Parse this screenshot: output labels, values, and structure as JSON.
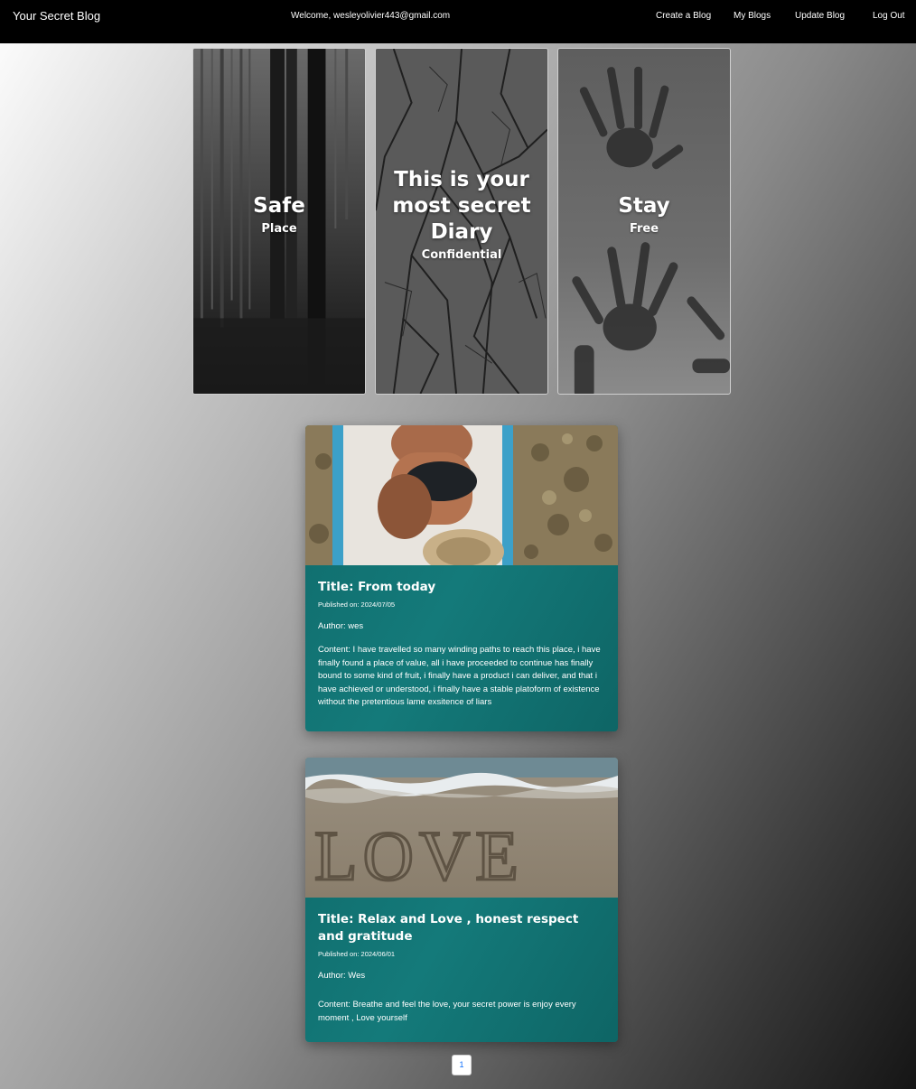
{
  "navbar": {
    "brand": "Your Secret Blog",
    "welcome": "Welcome, wesleyolivier443@gmail.com",
    "links": [
      "Create a Blog",
      "My Blogs",
      "Update Blog",
      "Log Out"
    ]
  },
  "hero": [
    {
      "title": "Safe",
      "subtitle": "Place"
    },
    {
      "title": "This is your most secret Diary",
      "subtitle": "Confidential"
    },
    {
      "title": "Stay",
      "subtitle": "Free"
    }
  ],
  "posts": [
    {
      "title": "Title: From today",
      "published": "Published on: 2024/07/05",
      "author": "Author: wes",
      "content": "Content: I have travelled so many winding paths to reach this place, i have finally found a place of value, all i have proceeded to continue has finally bound to some kind of fruit, i finally have a product i can deliver, and that i have achieved or understood, i finally have a stable platoform of existence without the pretentious lame exsitence of liars"
    },
    {
      "title": "Title: Relax and Love , honest respect and gratitude",
      "published": "Published on: 2024/06/01",
      "author": "Author: Wes",
      "content": "Content: Breathe and feel the love, your secret power is enjoy every moment , Love yourself",
      "image_text": "LOVE"
    }
  ],
  "pagination": {
    "current": "1"
  }
}
